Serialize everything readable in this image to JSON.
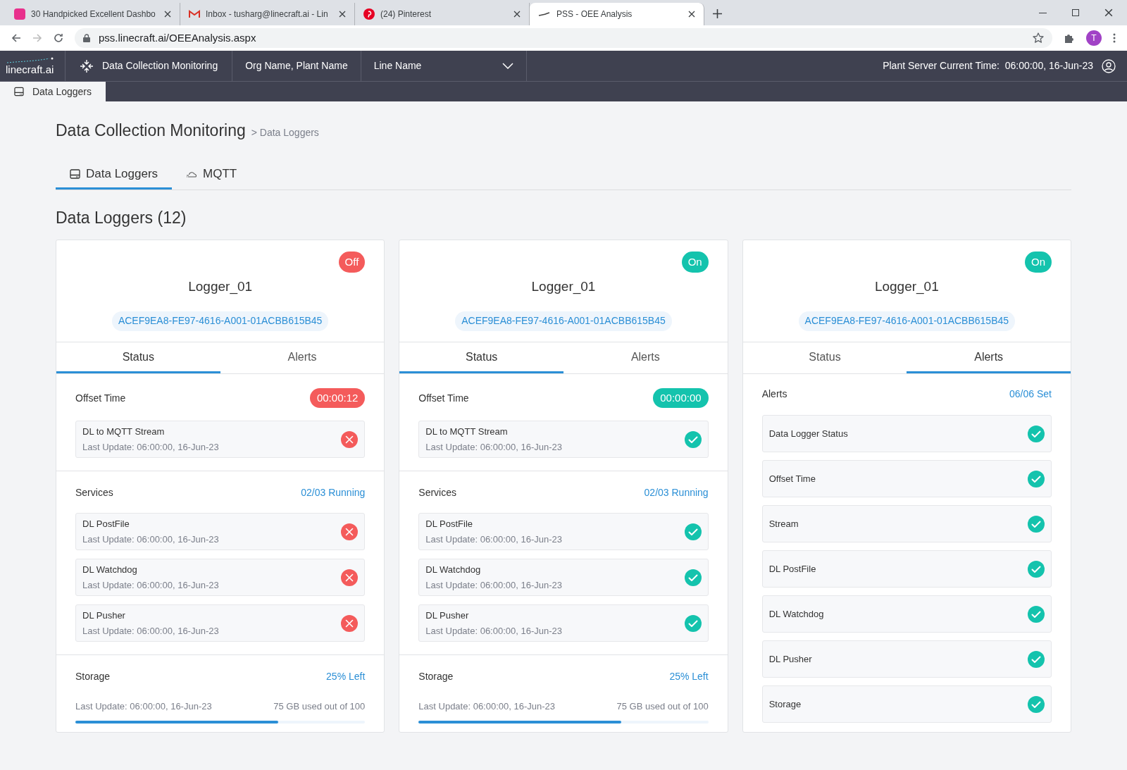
{
  "browser": {
    "tabs": [
      {
        "title": "30 Handpicked Excellent Dashbo",
        "kind": "m",
        "selected": false
      },
      {
        "title": "Inbox - tusharg@linecraft.ai - Lin",
        "kind": "mail",
        "selected": false
      },
      {
        "title": "(24) Pinterest",
        "kind": "pin",
        "selected": false
      },
      {
        "title": "PSS - OEE Analysis",
        "kind": "line",
        "selected": true
      }
    ],
    "url": "pss.linecraft.ai/OEEAnalysis.aspx",
    "profile": "T"
  },
  "header": {
    "logo": "linecraft.ai",
    "module": "Data Collection Monitoring",
    "org": "Org Name, Plant Name",
    "line": "Line Name",
    "time_label": "Plant Server Current Time:",
    "time": "06:00:00, 16-Jun-23"
  },
  "subnav": [
    {
      "label": "Data Loggers",
      "selected": true
    }
  ],
  "page": {
    "title": "Data Collection Monitoring",
    "breadcrumb": "> Data Loggers",
    "tabs": [
      {
        "label": "Data Loggers",
        "kind": "logger",
        "selected": true
      },
      {
        "label": "MQTT",
        "kind": "cloud",
        "selected": false
      }
    ],
    "section": "Data Loggers (12)"
  },
  "loggers": [
    {
      "status": "Off",
      "on": false,
      "name": "Logger_01",
      "id": "ACEF9EA8-FE97-4616-A001-01ACBB615B45",
      "tabs": [
        {
          "label": "Status",
          "selected": true
        },
        {
          "label": "Alerts",
          "selected": false
        }
      ],
      "offset": {
        "label": "Offset Time",
        "value": "00:00:12",
        "ok": false
      },
      "stream": {
        "name": "DL to MQTT Stream",
        "updated": "Last Update: 06:00:00, 16-Jun-23",
        "ok": false
      },
      "services": {
        "label": "Services",
        "summary": "02/03 Running",
        "items": [
          {
            "name": "DL PostFile",
            "updated": "Last Update: 06:00:00, 16-Jun-23",
            "ok": false
          },
          {
            "name": "DL Watchdog",
            "updated": "Last Update: 06:00:00, 16-Jun-23",
            "ok": false
          },
          {
            "name": "DL Pusher",
            "updated": "Last Update: 06:00:00, 16-Jun-23",
            "ok": false
          }
        ]
      },
      "storage": {
        "label": "Storage",
        "left": "25% Left",
        "updated": "Last Update: 06:00:00, 16-Jun-23",
        "used": "75 GB used out of 100",
        "level": 0.7
      }
    },
    {
      "status": "On",
      "on": true,
      "name": "Logger_01",
      "id": "ACEF9EA8-FE97-4616-A001-01ACBB615B45",
      "tabs": [
        {
          "label": "Status",
          "selected": true
        },
        {
          "label": "Alerts",
          "selected": false
        }
      ],
      "offset": {
        "label": "Offset Time",
        "value": "00:00:00",
        "ok": true
      },
      "stream": {
        "name": "DL to MQTT Stream",
        "updated": "Last Update: 06:00:00, 16-Jun-23",
        "ok": true
      },
      "services": {
        "label": "Services",
        "summary": "02/03 Running",
        "items": [
          {
            "name": "DL PostFile",
            "updated": "Last Update: 06:00:00, 16-Jun-23",
            "ok": true
          },
          {
            "name": "DL Watchdog",
            "updated": "Last Update: 06:00:00, 16-Jun-23",
            "ok": true
          },
          {
            "name": "DL Pusher",
            "updated": "Last Update: 06:00:00, 16-Jun-23",
            "ok": true
          }
        ]
      },
      "storage": {
        "label": "Storage",
        "left": "25% Left",
        "updated": "Last Update: 06:00:00, 16-Jun-23",
        "used": "75 GB used out of 100",
        "level": 0.7
      }
    },
    {
      "status": "On",
      "on": true,
      "name": "Logger_01",
      "id": "ACEF9EA8-FE97-4616-A001-01ACBB615B45",
      "tabs": [
        {
          "label": "Status",
          "selected": false
        },
        {
          "label": "Alerts",
          "selected": true
        }
      ],
      "alerts": {
        "label": "Alerts",
        "summary": "06/06 Set",
        "items": [
          {
            "name": "Data Logger Status",
            "ok": true
          },
          {
            "name": "Offset Time",
            "ok": true
          },
          {
            "name": "Stream",
            "ok": true
          },
          {
            "name": "DL PostFile",
            "ok": true
          },
          {
            "name": "DL Watchdog",
            "ok": true
          },
          {
            "name": "DL Pusher",
            "ok": true
          },
          {
            "name": "Storage",
            "ok": true
          }
        ]
      }
    }
  ]
}
